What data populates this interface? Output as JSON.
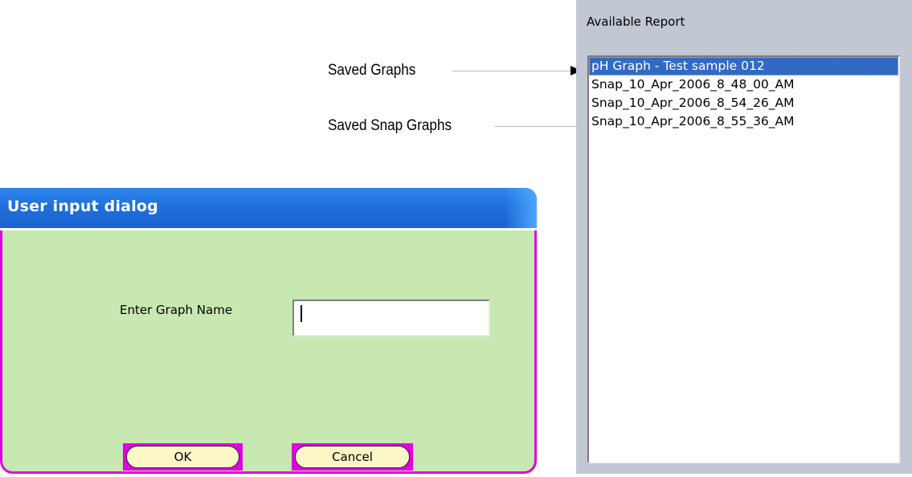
{
  "annotations": {
    "saved_graphs": "Saved Graphs",
    "saved_snap_graphs": "Saved Snap Graphs"
  },
  "dialog": {
    "title": "User input dialog",
    "field_label": "Enter Graph Name",
    "graph_name_value": "",
    "ok_label": "OK",
    "cancel_label": "Cancel"
  },
  "report_panel": {
    "title": "Available Report",
    "items": [
      {
        "label": "pH Graph - Test sample 012",
        "selected": true
      },
      {
        "label": "Snap_10_Apr_2006_8_48_00_AM",
        "selected": false
      },
      {
        "label": "Snap_10_Apr_2006_8_54_26_AM",
        "selected": false
      },
      {
        "label": "Snap_10_Apr_2006_8_55_36_AM",
        "selected": false
      }
    ]
  },
  "colors": {
    "titlebar": "#1f6fdc",
    "dialog_body": "#c7e8b1",
    "dialog_border": "#e000e0",
    "button_face": "#fdf7c8",
    "selection": "#316ac5",
    "panel_background": "#c2c7d4"
  }
}
